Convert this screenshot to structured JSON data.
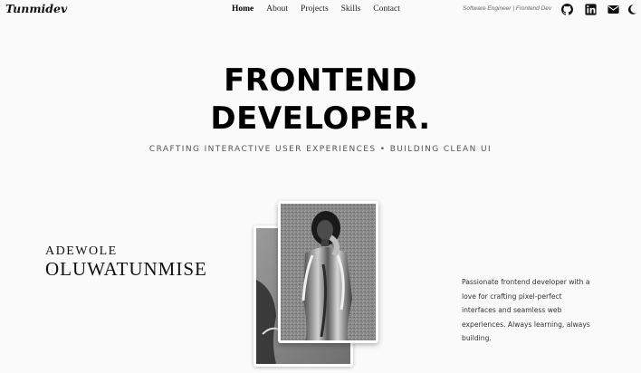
{
  "brand": {
    "logo": "Tunmidev"
  },
  "nav": {
    "items": [
      {
        "label": "Home",
        "active": true
      },
      {
        "label": "About",
        "active": false
      },
      {
        "label": "Projects",
        "active": false
      },
      {
        "label": "Skills",
        "active": false
      },
      {
        "label": "Contact",
        "active": false
      }
    ],
    "tagline": "Software Engineer | Frontend Dev",
    "icons": [
      "github-icon",
      "linkedin-icon",
      "mail-icon",
      "moon-icon"
    ]
  },
  "hero": {
    "title_line1": "FRONTEND",
    "title_line2": "DEVELOPER.",
    "subtitle": "CRAFTING INTERACTIVE USER EXPERIENCES • BUILDING CLEAN UI"
  },
  "profile": {
    "first_name": "ADEWOLE",
    "last_name": "OLUWATUNMISE",
    "bio": "Passionate frontend developer with a love for crafting pixel-perfect interfaces and seamless web experiences. Always learning, always building."
  },
  "colors": {
    "background": "#fafafa",
    "text": "#111111",
    "muted": "#555555"
  }
}
